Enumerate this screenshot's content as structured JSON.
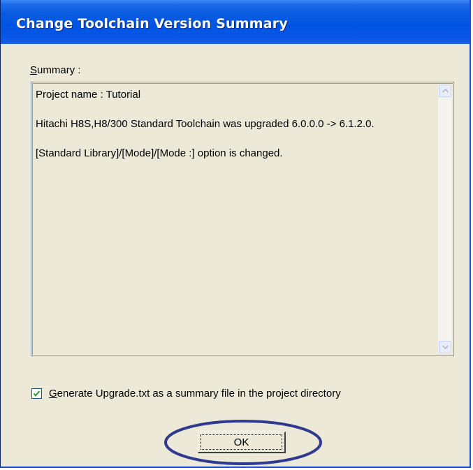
{
  "window": {
    "title": "Change Toolchain Version Summary",
    "titlebar_color": "#0054e3",
    "face_color": "#ece9d8"
  },
  "summary": {
    "label": "Summary :",
    "label_mnemonic": "S",
    "label_rest": "ummary :",
    "lines": [
      "Project name : Tutorial",
      "Hitachi H8S,H8/300 Standard Toolchain was upgraded 6.0.0.0 -> 6.1.2.0.",
      "[Standard Library]/[Mode]/[Mode :] option is changed."
    ]
  },
  "scrollbar": {
    "up_icon": "scroll-up-arrow-icon",
    "down_icon": "scroll-down-arrow-icon"
  },
  "checkbox": {
    "checked": true,
    "label": "Generate Upgrade.txt as a summary file in the project directory",
    "label_mnemonic": "G",
    "label_rest": "enerate Upgrade.txt as a summary file in the project directory"
  },
  "ok_button": {
    "label": "OK"
  },
  "annotation": {
    "shape": "ellipse",
    "color": "#2f3a8f",
    "target": "ok-button"
  }
}
